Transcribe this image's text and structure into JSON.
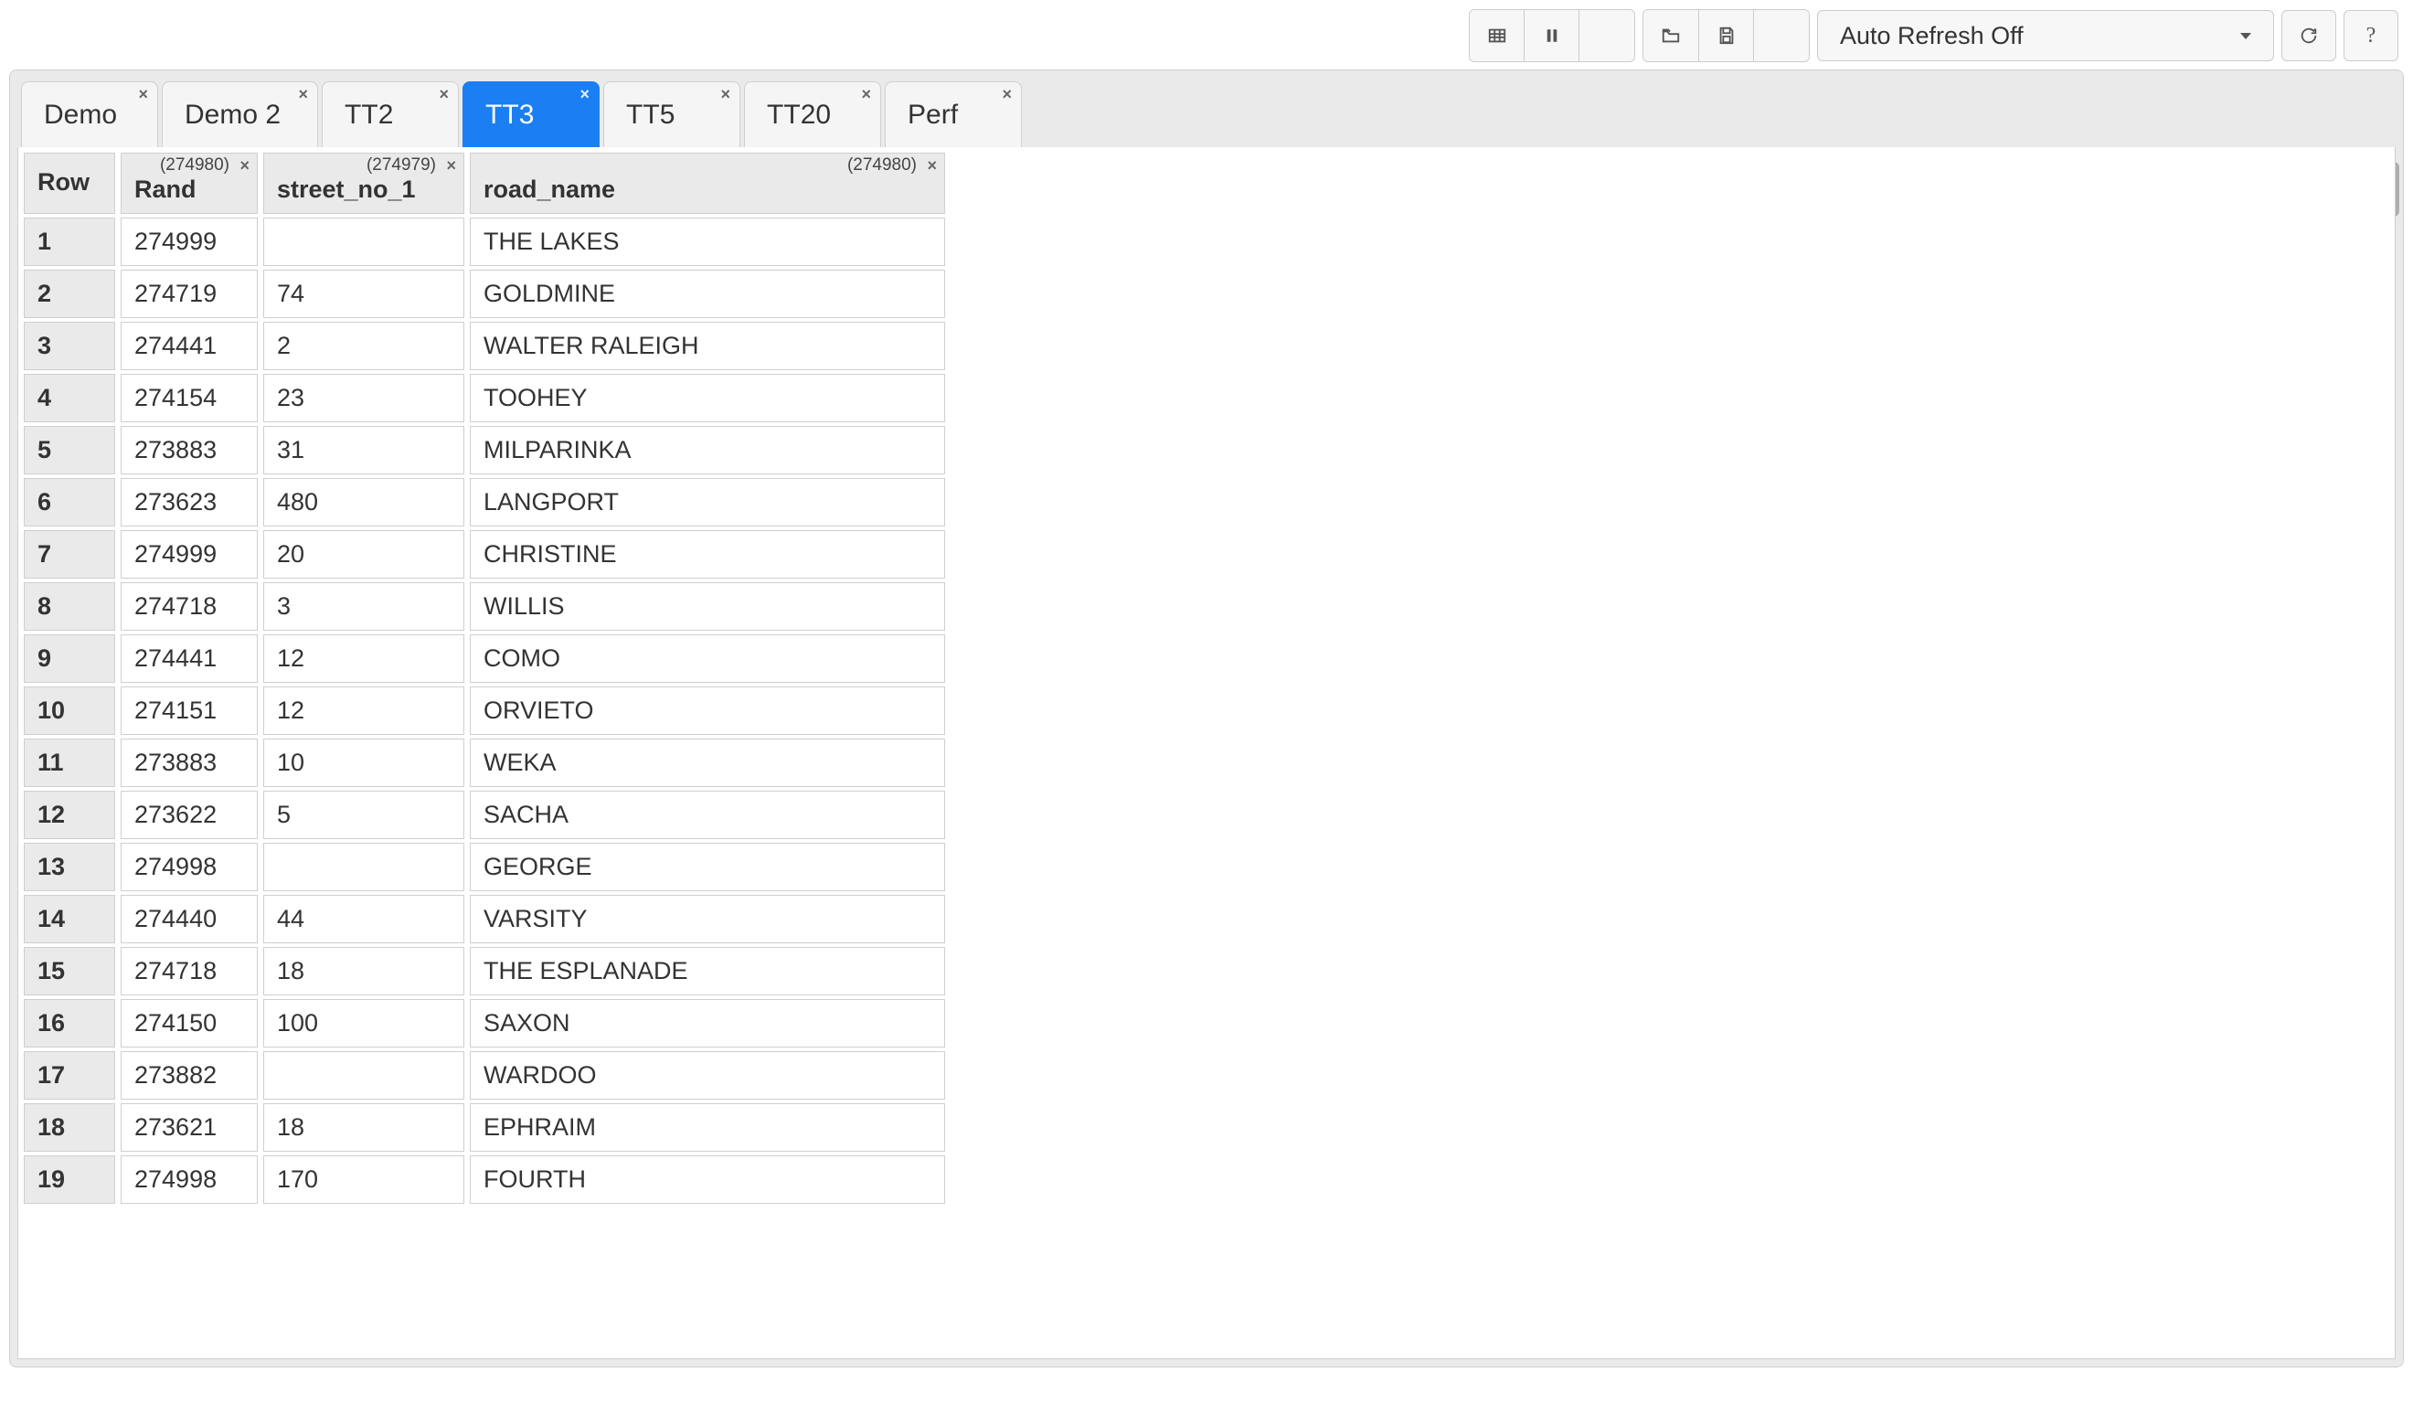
{
  "toolbar": {
    "refresh_dropdown": "Auto Refresh Off"
  },
  "tabs": [
    {
      "label": "Demo",
      "active": false
    },
    {
      "label": "Demo 2",
      "active": false
    },
    {
      "label": "TT2",
      "active": false
    },
    {
      "label": "TT3",
      "active": true
    },
    {
      "label": "TT5",
      "active": false
    },
    {
      "label": "TT20",
      "active": false
    },
    {
      "label": "Perf",
      "active": false
    }
  ],
  "table": {
    "columns": [
      {
        "label": "Row",
        "count": ""
      },
      {
        "label": "Rand",
        "count": "(274980)"
      },
      {
        "label": "street_no_1",
        "count": "(274979)"
      },
      {
        "label": "road_name",
        "count": "(274980)"
      }
    ],
    "rows": [
      {
        "n": "1",
        "rand": "274999",
        "sno": "",
        "road": "THE LAKES"
      },
      {
        "n": "2",
        "rand": "274719",
        "sno": "74",
        "road": "GOLDMINE"
      },
      {
        "n": "3",
        "rand": "274441",
        "sno": "2",
        "road": "WALTER RALEIGH"
      },
      {
        "n": "4",
        "rand": "274154",
        "sno": "23",
        "road": "TOOHEY"
      },
      {
        "n": "5",
        "rand": "273883",
        "sno": "31",
        "road": "MILPARINKA"
      },
      {
        "n": "6",
        "rand": "273623",
        "sno": "480",
        "road": "LANGPORT"
      },
      {
        "n": "7",
        "rand": "274999",
        "sno": "20",
        "road": "CHRISTINE"
      },
      {
        "n": "8",
        "rand": "274718",
        "sno": "3",
        "road": "WILLIS"
      },
      {
        "n": "9",
        "rand": "274441",
        "sno": "12",
        "road": "COMO"
      },
      {
        "n": "10",
        "rand": "274151",
        "sno": "12",
        "road": "ORVIETO"
      },
      {
        "n": "11",
        "rand": "273883",
        "sno": "10",
        "road": "WEKA"
      },
      {
        "n": "12",
        "rand": "273622",
        "sno": "5",
        "road": "SACHA"
      },
      {
        "n": "13",
        "rand": "274998",
        "sno": "",
        "road": "GEORGE"
      },
      {
        "n": "14",
        "rand": "274440",
        "sno": "44",
        "road": "VARSITY"
      },
      {
        "n": "15",
        "rand": "274718",
        "sno": "18",
        "road": "THE ESPLANADE"
      },
      {
        "n": "16",
        "rand": "274150",
        "sno": "100",
        "road": "SAXON"
      },
      {
        "n": "17",
        "rand": "273882",
        "sno": "",
        "road": "WARDOO"
      },
      {
        "n": "18",
        "rand": "273621",
        "sno": "18",
        "road": "EPHRAIM"
      },
      {
        "n": "19",
        "rand": "274998",
        "sno": "170",
        "road": "FOURTH"
      }
    ]
  }
}
